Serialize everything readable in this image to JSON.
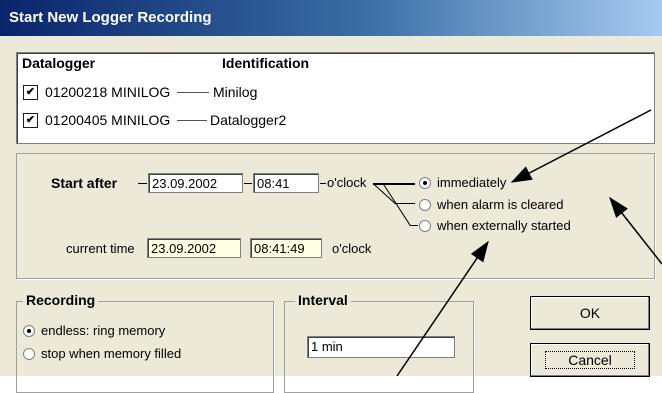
{
  "window": {
    "title": "Start New Logger Recording"
  },
  "list": {
    "col_datalogger": "Datalogger",
    "col_identification": "Identification",
    "rows": [
      {
        "code": "01200218 MINILOG",
        "name": "Minilog",
        "checked": true
      },
      {
        "code": "01200405 MINILOG",
        "name": "Datalogger2",
        "checked": true
      }
    ]
  },
  "start": {
    "label": "Start after",
    "date": "23.09.2002",
    "time": "08:41",
    "oclock": "o'clock",
    "options": [
      "immediately",
      "when alarm is cleared",
      "when externally started"
    ],
    "selected": "immediately",
    "current_label": "current time",
    "current_date": "23.09.2002",
    "current_time": "08:41:49",
    "current_oclock": "o'clock"
  },
  "recording": {
    "legend": "Recording",
    "options": [
      "endless: ring memory",
      "stop when memory filled"
    ],
    "selected": "endless: ring memory"
  },
  "interval": {
    "legend": "Interval",
    "value": "1 min"
  },
  "buttons": {
    "ok": "OK",
    "cancel": "Cancel"
  },
  "checkmark_glyph": "✔"
}
